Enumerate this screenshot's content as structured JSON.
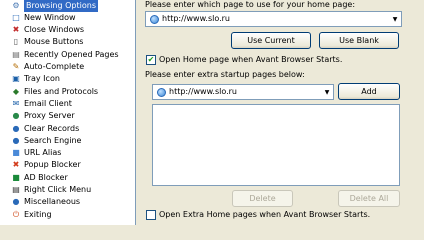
{
  "nav": {
    "items": [
      {
        "label": "Browsing Options",
        "icon": "browsing-options-icon",
        "glyph": "⚙",
        "color": "#4a7ab5",
        "selected": true
      },
      {
        "label": "New Window",
        "icon": "new-window-icon",
        "glyph": "□",
        "color": "#2a6ab8"
      },
      {
        "label": "Close Windows",
        "icon": "close-windows-icon",
        "glyph": "✖",
        "color": "#c22a2a"
      },
      {
        "label": "Mouse Buttons",
        "icon": "mouse-icon",
        "glyph": "▯",
        "color": "#555555"
      },
      {
        "label": "Recently Opened Pages",
        "icon": "recent-pages-icon",
        "glyph": "▤",
        "color": "#6b6b6b"
      },
      {
        "label": "Auto-Complete",
        "icon": "auto-complete-icon",
        "glyph": "✎",
        "color": "#b36b00"
      },
      {
        "label": "Tray Icon",
        "icon": "tray-icon",
        "glyph": "▣",
        "color": "#1a5fa8"
      },
      {
        "label": "Files and Protocols",
        "icon": "files-protocols-icon",
        "glyph": "◆",
        "color": "#2a7a2a"
      },
      {
        "label": "Email Client",
        "icon": "email-icon",
        "glyph": "✉",
        "color": "#1a5fa8"
      },
      {
        "label": "Proxy Server",
        "icon": "proxy-icon",
        "glyph": "●",
        "color": "#2a8a4a"
      },
      {
        "label": "Clear Records",
        "icon": "clear-records-icon",
        "glyph": "●",
        "color": "#2a6ab8"
      },
      {
        "label": "Search Engine",
        "icon": "search-engine-icon",
        "glyph": "●",
        "color": "#2a6ab8"
      },
      {
        "label": "URL Alias",
        "icon": "url-alias-icon",
        "glyph": "■",
        "color": "#4a8ad8"
      },
      {
        "label": "Popup Blocker",
        "icon": "popup-blocker-icon",
        "glyph": "✖",
        "color": "#d23a1a"
      },
      {
        "label": "AD Blocker",
        "icon": "ad-blocker-icon",
        "glyph": "■",
        "color": "#1a8a3a"
      },
      {
        "label": "Right Click Menu",
        "icon": "right-click-menu-icon",
        "glyph": "▤",
        "color": "#333333"
      },
      {
        "label": "Miscellaneous",
        "icon": "miscellaneous-icon",
        "glyph": "●",
        "color": "#2a6ab8"
      },
      {
        "label": "Exiting",
        "icon": "exiting-icon",
        "glyph": "⏻",
        "color": "#d04a1a"
      }
    ]
  },
  "home": {
    "prompt": "Please enter which page to use for your home page:",
    "url": "http://www.slo.ru",
    "use_current": "Use Current",
    "use_blank": "Use Blank"
  },
  "open_home": {
    "label": "Open Home page when Avant Browser Starts.",
    "checked": true
  },
  "extra": {
    "prompt": "Please enter extra startup pages below:",
    "url": "http://www.slo.ru",
    "add": "Add",
    "delete": "Delete",
    "delete_all": "Delete All"
  },
  "open_extra": {
    "label": "Open Extra Home pages when Avant Browser Starts.",
    "checked": false
  },
  "colors": {
    "selection": "#316ac5",
    "border": "#7f9db9",
    "check_mark": "#21a121"
  }
}
